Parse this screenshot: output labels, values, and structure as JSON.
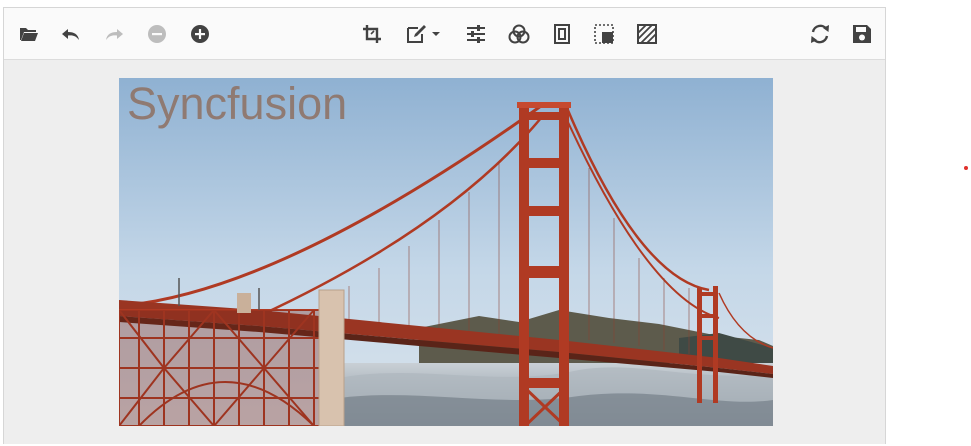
{
  "toolbar": {
    "left": [
      {
        "name": "open-icon",
        "state": "enabled"
      },
      {
        "name": "undo-icon",
        "state": "enabled"
      },
      {
        "name": "redo-icon",
        "state": "disabled"
      },
      {
        "name": "zoom-out-icon",
        "state": "disabled"
      },
      {
        "name": "zoom-in-icon",
        "state": "enabled"
      }
    ],
    "center": [
      {
        "name": "crop-icon"
      },
      {
        "name": "annotate-icon",
        "dropdown": true
      },
      {
        "name": "adjust-icon"
      },
      {
        "name": "filters-icon"
      },
      {
        "name": "frame-icon"
      },
      {
        "name": "resize-icon"
      },
      {
        "name": "redact-icon"
      }
    ],
    "right": [
      {
        "name": "reset-icon"
      },
      {
        "name": "save-icon"
      }
    ]
  },
  "image": {
    "watermark_text": "Syncfusion",
    "subject": "golden-gate-bridge-photo"
  },
  "colors": {
    "icon": "#424242",
    "icon_disabled": "#bdbdbd",
    "toolbar_bg": "#fafafa",
    "canvas_bg": "#eeeeee",
    "bridge": "#b03a23",
    "watermark": "#8f7468"
  }
}
